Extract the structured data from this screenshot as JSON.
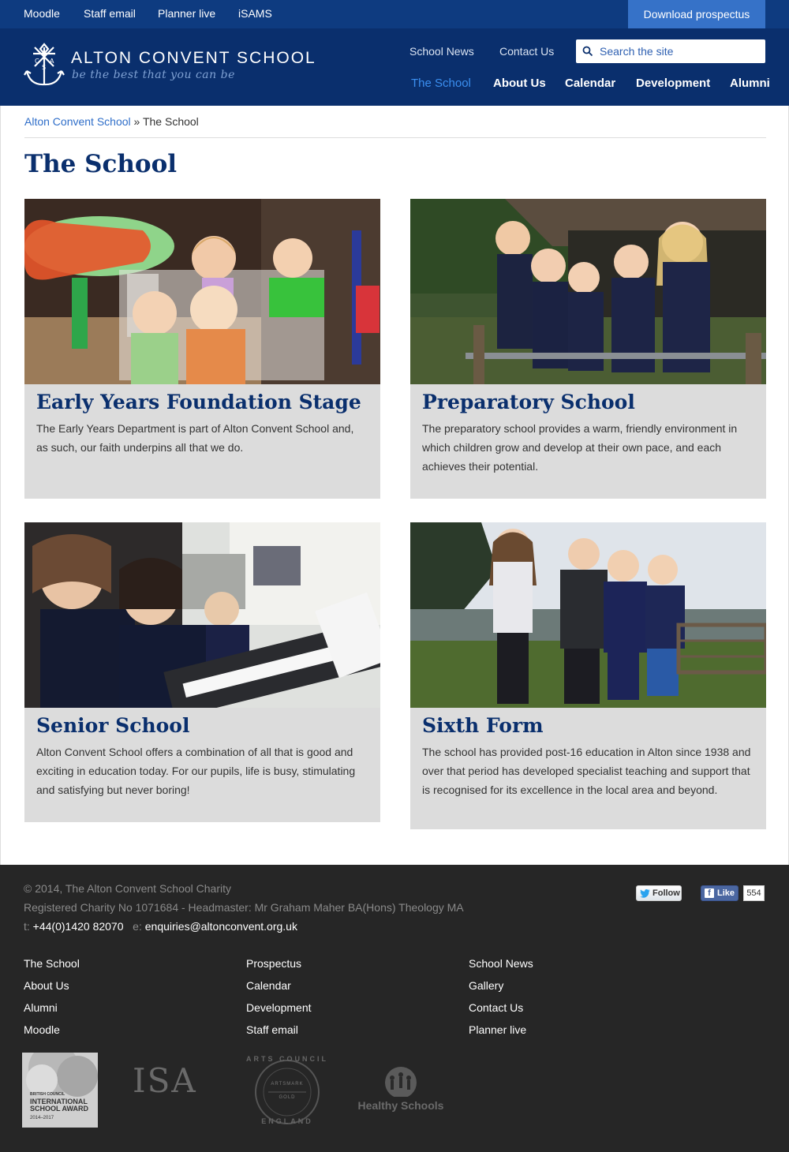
{
  "topbar": {
    "links": [
      "Moodle",
      "Staff email",
      "Planner live",
      "iSAMS"
    ],
    "download": "Download prospectus"
  },
  "header": {
    "title": "ALTON CONVENT SCHOOL",
    "tagline": "be the best that you can be",
    "secondary_links": [
      "School News",
      "Contact Us"
    ],
    "search_placeholder": "Search the site",
    "nav": [
      "The School",
      "About Us",
      "Calendar",
      "Development",
      "Alumni"
    ],
    "active_nav": "The School",
    "accent_color": "#3b8ff0",
    "brand_color": "#0a2f6d"
  },
  "breadcrumb": {
    "home": "Alton Convent School",
    "sep": "»",
    "current": "The School"
  },
  "page_title": "The School",
  "cards": [
    {
      "title": "Early Years Foundation Stage",
      "text": "The Early Years Department is part of Alton Convent School and, as such, our faith underpins all that we do."
    },
    {
      "title": "Preparatory School",
      "text": "The preparatory school provides a warm, friendly environment in which children grow and develop at their own pace, and each achieves their potential."
    },
    {
      "title": "Senior School",
      "text": "Alton Convent School offers a combination of all that is good and exciting in education today. For our pupils, life is busy, stimulating and satisfying but never boring!"
    },
    {
      "title": "Sixth Form",
      "text": "The school has provided post-16 education in Alton since 1938 and over that period has developed specialist teaching and support that is recognised for its excellence in the local area and beyond."
    }
  ],
  "footer": {
    "copyright": "© 2014, The Alton Convent School Charity",
    "registered": "Registered Charity No 1071684 - Headmaster: Mr Graham Maher BA(Hons) Theology MA",
    "phone_label": "t:",
    "phone": "+44(0)1420 82070",
    "email_label": "e:",
    "email": "enquiries@altonconvent.org.uk",
    "twitter": "Follow",
    "facebook": "Like",
    "facebook_count": "554",
    "links_col1": [
      "The School",
      "About Us",
      "Alumni",
      "Moodle"
    ],
    "links_col2": [
      "Prospectus",
      "Calendar",
      "Development",
      "Staff email"
    ],
    "links_col3": [
      "School News",
      "Gallery",
      "Contact Us",
      "Planner live"
    ],
    "badges": {
      "intl_small": "BRITISH COUNCIL",
      "intl_title": "INTERNATIONAL SCHOOL AWARD",
      "intl_years": "2014–2017",
      "isa": "ISA",
      "arts_top": "ARTS COUNCIL",
      "arts_mid": "ARTSMARK",
      "arts_gold": "GOLD",
      "arts_bottom": "ENGLAND",
      "healthy": "Healthy Schools"
    }
  }
}
